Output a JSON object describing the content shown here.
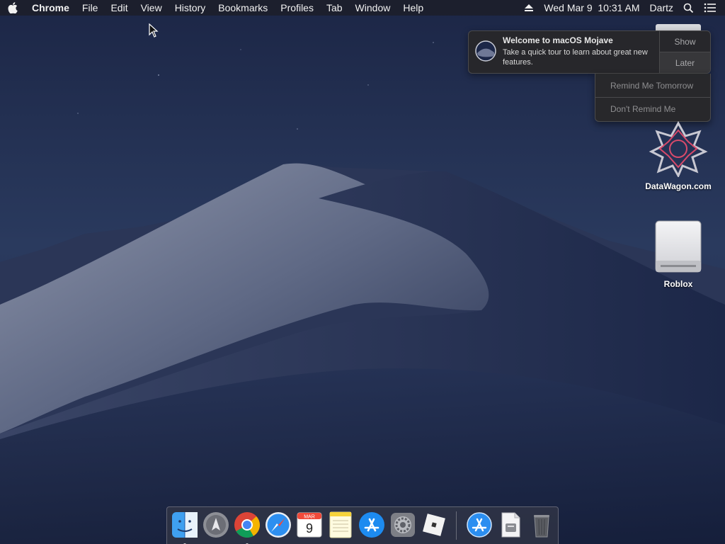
{
  "menubar": {
    "app_name": "Chrome",
    "items": [
      "File",
      "Edit",
      "View",
      "History",
      "Bookmarks",
      "Profiles",
      "Tab",
      "Window",
      "Help"
    ],
    "datetime": "Wed Mar 9  10:31 AM",
    "user": "Dartz",
    "icons": [
      "apple-icon",
      "eject-icon",
      "search-icon",
      "notification-center-icon"
    ]
  },
  "notification": {
    "title": "Welcome to macOS Mojave",
    "body": "Take a quick tour to learn about great new features.",
    "show_label": "Show",
    "later_label": "Later",
    "dropdown": [
      "Remind Me Tomorrow",
      "Don't Remind Me"
    ]
  },
  "desktop": {
    "icons": [
      {
        "label": "DataWagon.com",
        "icon": "datawagon-logo-icon"
      },
      {
        "label": "Roblox",
        "icon": "external-drive-icon"
      }
    ]
  },
  "dock": {
    "apps": [
      "finder-icon",
      "launchpad-icon",
      "chrome-icon",
      "safari-icon",
      "calendar-icon",
      "notes-icon",
      "app-store-icon",
      "system-preferences-icon",
      "roblox-icon",
      "app-store-downloads-icon",
      "installer-document-icon",
      "trash-icon"
    ],
    "calendar": {
      "month": "MAR",
      "day": "9"
    }
  },
  "colors": {
    "sky_top": "#1e2a4c",
    "sky_bottom": "#243a5c",
    "dune_light": "#9aa0b4",
    "dune_dark": "#1b2647",
    "menubar_bg": "#1c1f2a"
  }
}
